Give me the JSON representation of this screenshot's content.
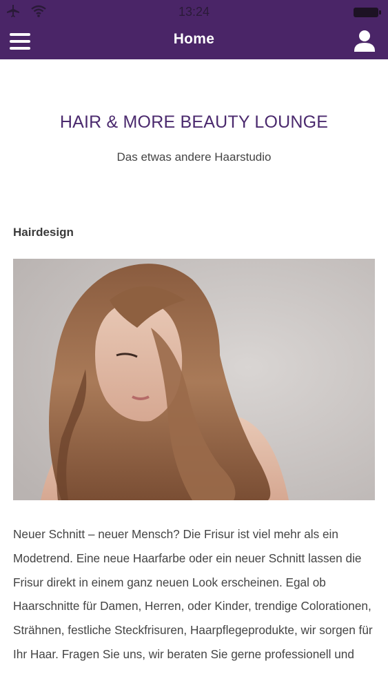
{
  "status_bar": {
    "time": "13:24",
    "icons": [
      "airplane-icon",
      "wifi-icon",
      "battery-icon"
    ]
  },
  "nav": {
    "title": "Home",
    "left_icon": "hamburger-menu-icon",
    "right_icon": "user-profile-icon"
  },
  "main": {
    "title": "HAIR & MORE BEAUTY LOUNGE",
    "subtitle": "Das etwas andere Haarstudio",
    "section_heading": "Hairdesign",
    "body_text": "Neuer Schnitt – neuer Mensch? Die Frisur ist viel mehr als ein Modetrend. Eine neue Haarfarbe oder ein neuer Schnitt lassen die Frisur direkt in einem ganz neuen Look erscheinen. Egal ob Haarschnitte für Damen, Herren, oder Kinder, trendige Colorationen, Strähnen, festliche Steckfrisuren, Haarpflegeprodukte, wir sorgen für Ihr Haar. Fragen Sie uns, wir beraten Sie gerne professionell und"
  },
  "colors": {
    "brand": "#4a2567",
    "title": "#4b2a6e",
    "text": "#444444"
  }
}
